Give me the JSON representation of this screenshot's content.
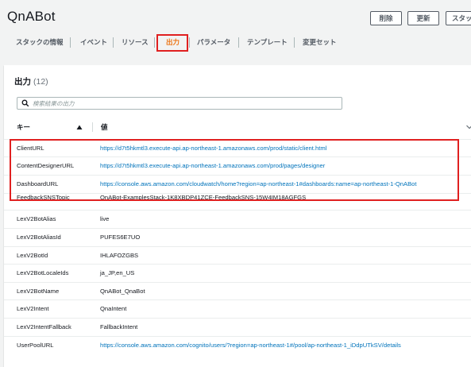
{
  "header": {
    "title": "QnABot"
  },
  "actions": {
    "delete_label": "削除",
    "update_label": "更新",
    "stack_actions_label": "スタッ"
  },
  "tabs": [
    {
      "label": "スタックの情報"
    },
    {
      "label": "イベント"
    },
    {
      "label": "リソース"
    },
    {
      "label": "出力",
      "active": true
    },
    {
      "label": "パラメータ"
    },
    {
      "label": "テンプレート"
    },
    {
      "label": "変更セット"
    }
  ],
  "outputs": {
    "title": "出力",
    "count": "(12)",
    "search_placeholder": "検索結果の出力",
    "columns": {
      "key": "キー",
      "value": "値"
    },
    "rows": [
      {
        "key": "ClientURL",
        "value": "https://d7t5hkmtl3.execute-api.ap-northeast-1.amazonaws.com/prod/static/client.html"
      },
      {
        "key": "ContentDesignerURL",
        "value": "https://d7t5hkmtl3.execute-api.ap-northeast-1.amazonaws.com/prod/pages/designer"
      },
      {
        "key": "DashboardURL",
        "value": "https://console.aws.amazon.com/cloudwatch/home?region=ap-northeast-1#dashboards:name=ap-northeast-1-QnABot"
      },
      {
        "key": "FeedbackSNSTopic",
        "value": "QnABot-ExamplesStack-1K8XBDP41ZCE-FeedbackSNS-15W4IM18AGFGS"
      },
      {
        "key": "LexV2BotAlias",
        "value": "live"
      },
      {
        "key": "LexV2BotAliasId",
        "value": "PUFES6E7UO"
      },
      {
        "key": "LexV2BotId",
        "value": "IHLAFOZGBS"
      },
      {
        "key": "LexV2BotLocaleIds",
        "value": "ja_JP,en_US"
      },
      {
        "key": "LexV2BotName",
        "value": "QnABot_QnaBot"
      },
      {
        "key": "LexV2Intent",
        "value": "QnaIntent"
      },
      {
        "key": "LexV2IntentFallback",
        "value": "FallbackIntent"
      },
      {
        "key": "UserPoolURL",
        "value": "https://console.aws.amazon.com/cognito/users/?region=ap-northeast-1#/pool/ap-northeast-1_iDdpUTkSV/details"
      }
    ]
  },
  "icons": {
    "search": "search-icon",
    "sort": "sort-ascending-icon",
    "filter": "chevron-down-icon"
  },
  "colors": {
    "link": "#0073bb",
    "active_tab": "#ec7211",
    "highlight": "#e02020"
  }
}
